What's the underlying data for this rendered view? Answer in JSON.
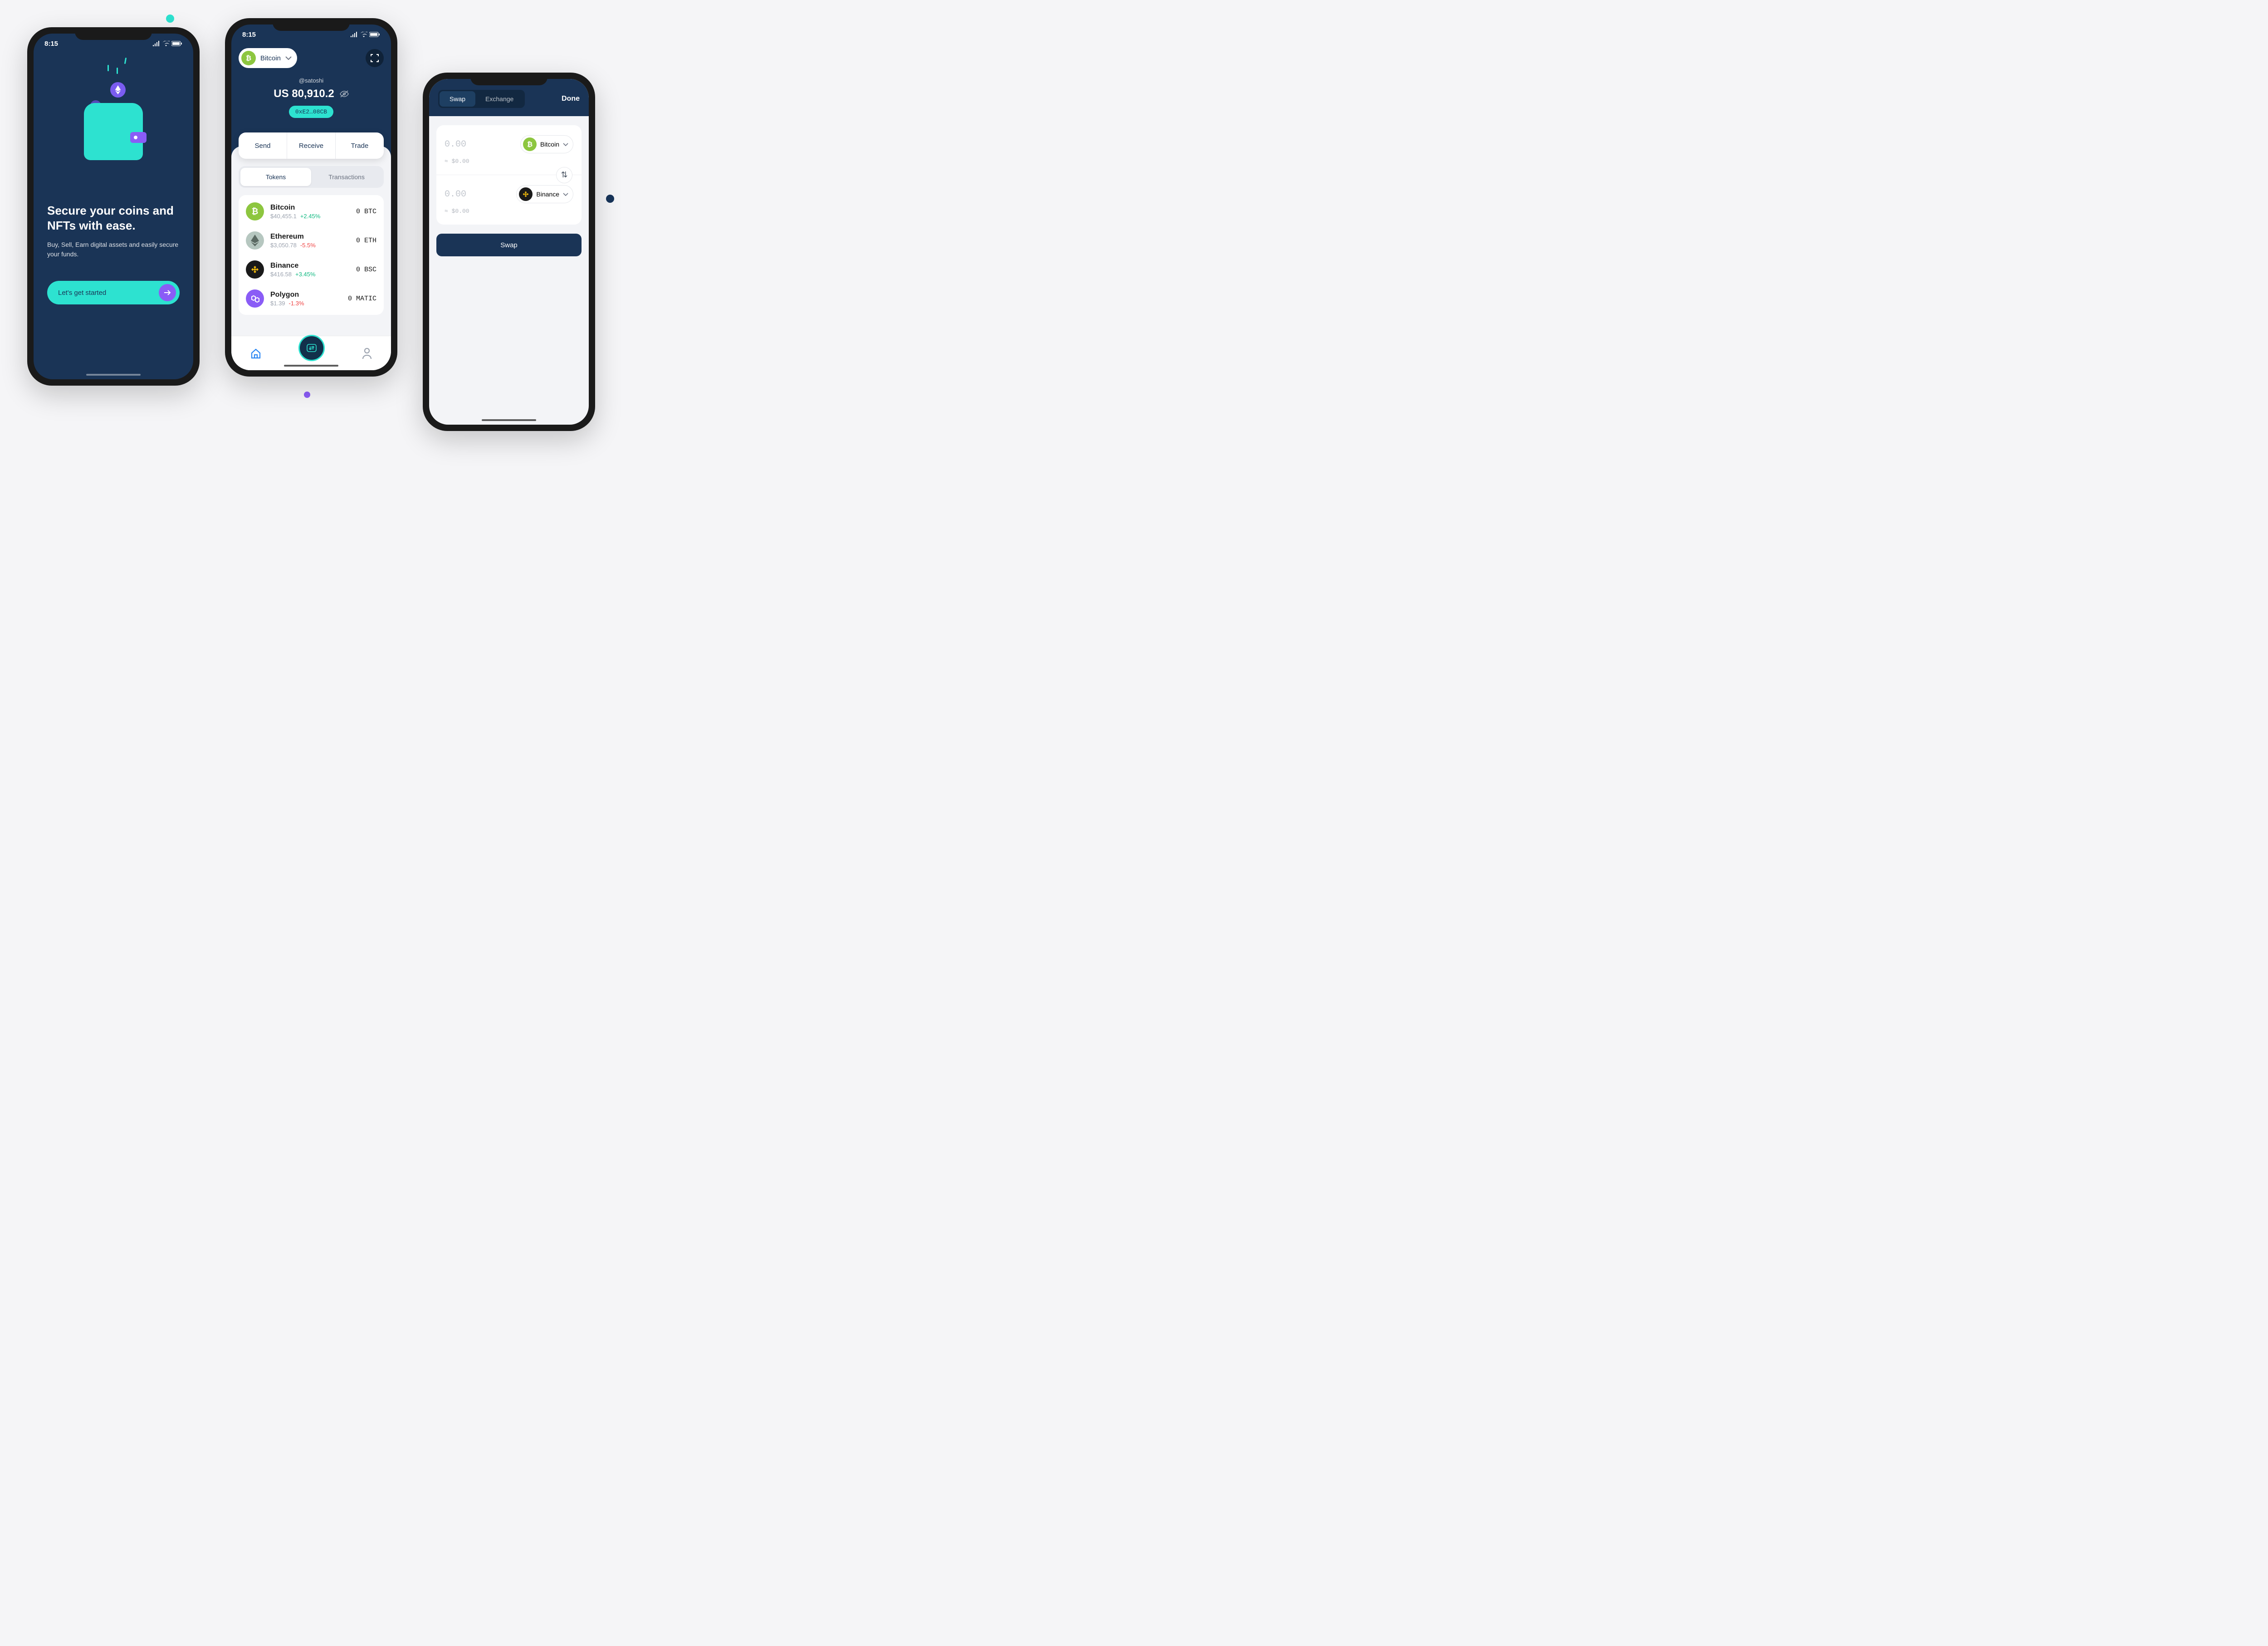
{
  "status": {
    "time": "8:15"
  },
  "onboard": {
    "title": "Secure your coins and NFTs with ease.",
    "subtitle": "Buy, Sell, Earn digital assets and easily secure your funds.",
    "cta": "Let's get started"
  },
  "home": {
    "selected_coin": "Bitcoin",
    "handle": "@satoshi",
    "balance": "US 80,910.2",
    "address": "0xE2…08CB",
    "actions": {
      "send": "Send",
      "receive": "Receive",
      "trade": "Trade"
    },
    "tabs": {
      "tokens": "Tokens",
      "transactions": "Transactions"
    },
    "tokens": [
      {
        "name": "Bitcoin",
        "price": "$40,455.1",
        "pct": "+2.45%",
        "pct_dir": "up",
        "amount": "0 BTC"
      },
      {
        "name": "Ethereum",
        "price": "$3,050.78",
        "pct": "-5.5%",
        "pct_dir": "down",
        "amount": "0 ETH"
      },
      {
        "name": "Binance",
        "price": "$416.58",
        "pct": "+3.45%",
        "pct_dir": "up",
        "amount": "0 BSC"
      },
      {
        "name": "Polygon",
        "price": "$1.39",
        "pct": "-1.3%",
        "pct_dir": "down",
        "amount": "0 MATIC"
      }
    ]
  },
  "swap": {
    "tabs": {
      "swap": "Swap",
      "exchange": "Exchange"
    },
    "done": "Done",
    "from": {
      "amount": "0.00",
      "approx": "≈ $0.00",
      "coin": "Bitcoin"
    },
    "to": {
      "amount": "0.00",
      "approx": "≈ $0.00",
      "coin": "Binance"
    },
    "button": "Swap"
  }
}
